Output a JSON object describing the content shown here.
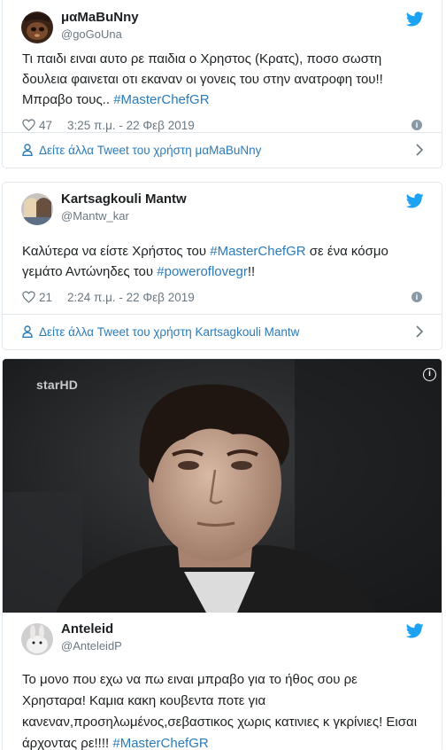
{
  "colors": {
    "link": "#2b7bb9",
    "bird": "#1da1f2",
    "muted": "#697882",
    "border": "#e1e8ed"
  },
  "tweets": [
    {
      "display_name": "μαMaBuNny",
      "handle": "@goGoUna",
      "text": "Τι παιδι ειναι αυτο ρε παιδια ο Χρηστος (Κρατς), ποσο σωστη δουλεια φαινεται οτι εκαναν οι γονεις του στην ανατροφη του!! Μπραβο τους.. ",
      "hashtag": "#MasterChefGR",
      "likes": "47",
      "timestamp": "3:25 π.μ. - 22 Φεβ 2019",
      "more_link": "Δείτε άλλα Tweet του χρήστη μαMaBuNny"
    },
    {
      "display_name": "Kartsagkouli Mantw",
      "handle": "@Mantw_kar",
      "text_before": "Καλύτερα να είστε Χρήστος του ",
      "hashtag1": "#MasterChefGR",
      "text_middle": " σε ένα κόσμο γεμάτο Αντώνηδες του ",
      "hashtag2": "#poweroflovegr",
      "text_after": "!!",
      "likes": "21",
      "timestamp": "2:24 π.μ. - 22 Φεβ 2019",
      "more_link": "Δείτε άλλα Tweet του χρήστη Kartsagkouli Mantw"
    },
    {
      "media_watermark": "starHD",
      "display_name": "Anteleid",
      "handle": "@AnteleidP",
      "text": "Το μονο που εχω να πω ειναι μπραβο για το ήθος σου ρε Χρησταρα! Καμια κακη κουβεντα ποτε για κανεναν,προσηλωμένος,σεβαστικος χωρις κατινιες κ γκρίνιες! Εισαι άρχοντας ρε!!!! ",
      "hashtag": "#MasterChefGR"
    }
  ],
  "icons": {
    "bird": "twitter-bird-icon",
    "heart": "heart-icon",
    "info": "info-icon",
    "person": "person-icon",
    "chevron": "chevron-right-icon"
  }
}
